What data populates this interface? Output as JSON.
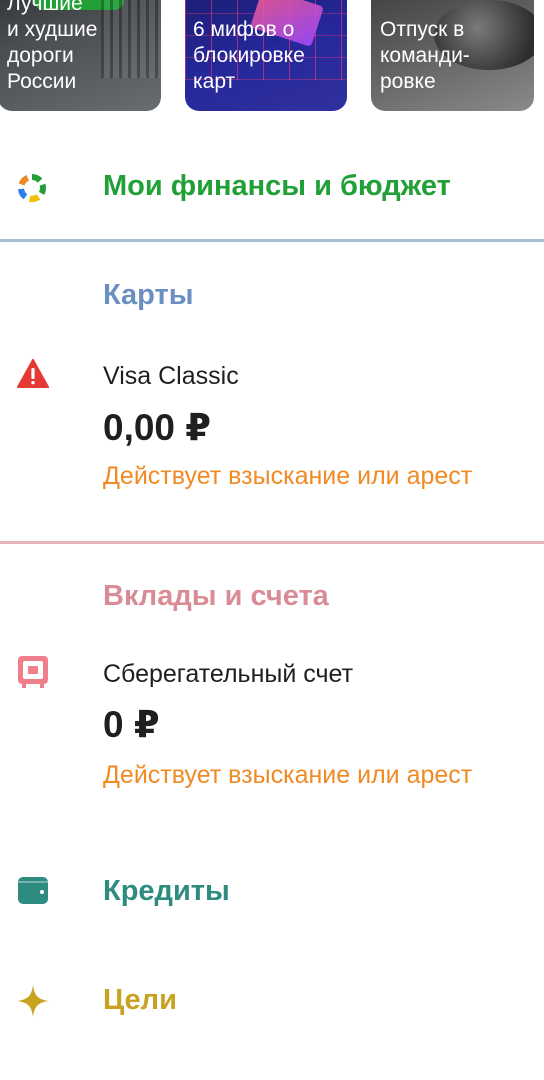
{
  "stories": [
    {
      "text": "Лучшие\nи худшие\nдороги\nРоссии"
    },
    {
      "text": "6 мифов о\nблокировке\nкарт"
    },
    {
      "text": "Отпуск в\nкоманди-\nровке"
    }
  ],
  "finance": {
    "title": "Мои финансы и бюджет",
    "icon": "pie-chart-icon"
  },
  "cards": {
    "title": "Карты",
    "items": [
      {
        "name": "Visa Classic",
        "amount": "0,00 ₽",
        "status": "Действует взыскание или арест",
        "icon": "warning-icon"
      }
    ]
  },
  "deposits": {
    "title": "Вклады и счета",
    "items": [
      {
        "name": "Сберегательный счет",
        "amount": "0 ₽",
        "status": "Действует взыскание или арест",
        "icon": "safe-icon"
      }
    ]
  },
  "credits": {
    "title": "Кредиты",
    "icon": "wallet-icon"
  },
  "goals": {
    "title": "Цели",
    "icon": "sparkle-icon"
  },
  "colors": {
    "finance": "#21a038",
    "cards": "#6a8fc0",
    "deposits": "#d98c96",
    "warning": "#e53935",
    "status": "#f08a24",
    "credits": "#2e8b80",
    "goals": "#c9a21f"
  }
}
